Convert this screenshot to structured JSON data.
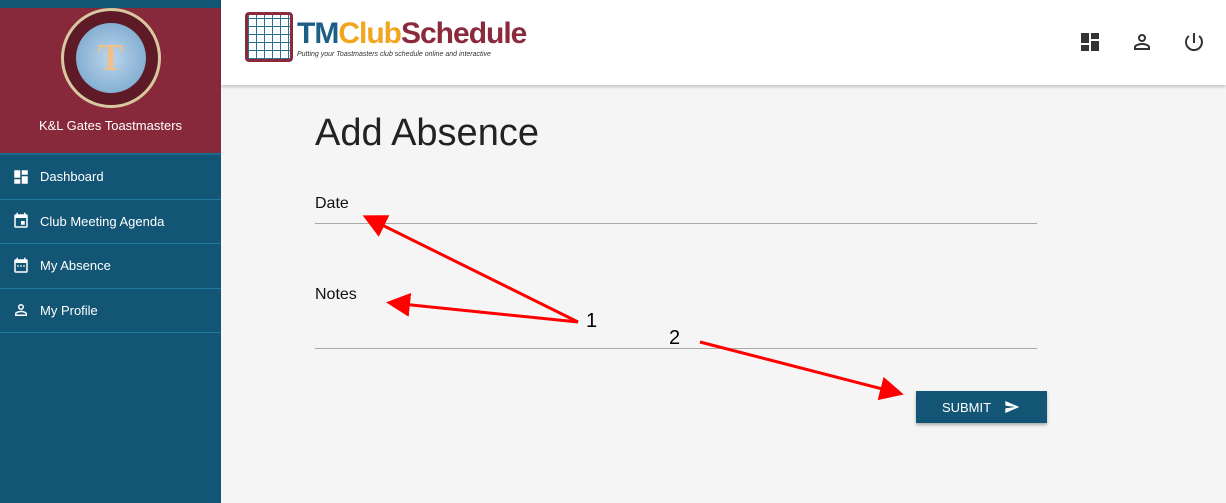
{
  "sidebar": {
    "club_name": "K&L Gates Toastmasters",
    "logo_text": "T",
    "items": [
      {
        "label": "Dashboard",
        "icon": "dashboard-icon"
      },
      {
        "label": "Club Meeting Agenda",
        "icon": "event-icon"
      },
      {
        "label": "My Absence",
        "icon": "calendar-icon"
      },
      {
        "label": "My Profile",
        "icon": "person-icon"
      }
    ]
  },
  "header": {
    "logo": {
      "part1": "TM",
      "part2": "Club",
      "part3": "Schedule",
      "tagline": "Putting your Toastmasters club schedule online and interactive"
    },
    "icons": [
      "dashboard-icon",
      "person-icon",
      "power-icon"
    ]
  },
  "main": {
    "title": "Add Absence",
    "date_label": "Date",
    "notes_label": "Notes",
    "submit_label": "SUBMIT"
  },
  "annotations": {
    "label1": "1",
    "label2": "2",
    "color": "#ff0000"
  },
  "colors": {
    "sidebar": "#135574",
    "brand": "#87293a"
  }
}
